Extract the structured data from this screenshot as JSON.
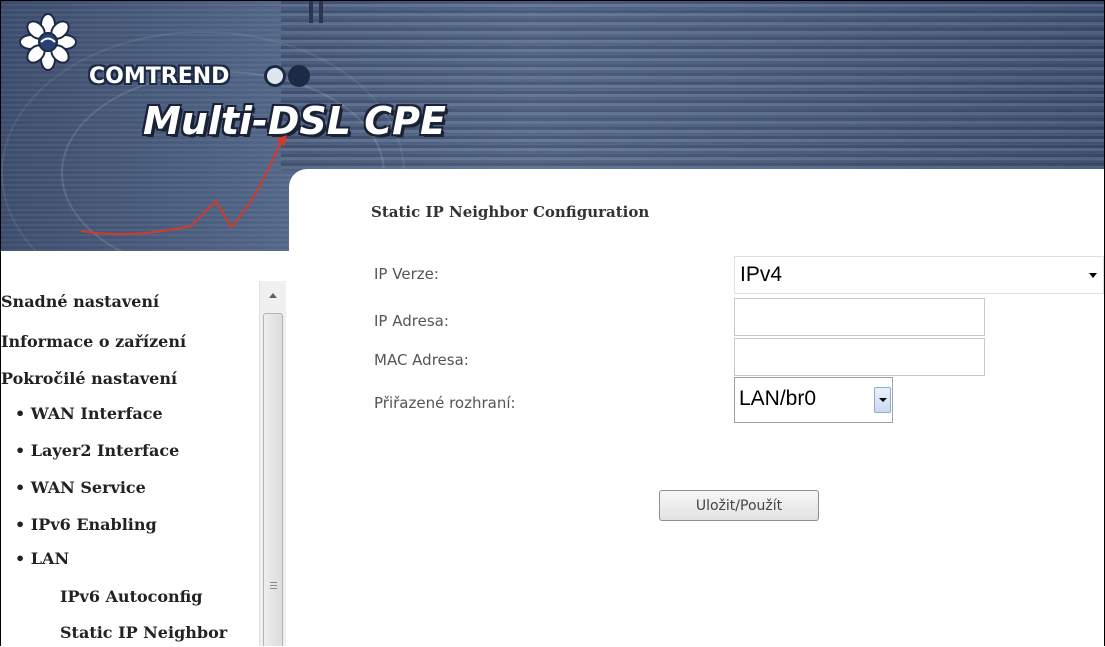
{
  "header": {
    "brand": "COMTREND",
    "product": "Multi-DSL CPE",
    "logo_icon": "flower-logo-icon"
  },
  "sidebar": {
    "items": [
      {
        "label": "Snadné nastavení"
      },
      {
        "label": "Informace o zařízení"
      },
      {
        "label": "Pokročilé nastavení"
      },
      {
        "label": "• WAN Interface"
      },
      {
        "label": "• Layer2 Interface"
      },
      {
        "label": "• WAN Service"
      },
      {
        "label": "• IPv6 Enabling"
      },
      {
        "label": "• LAN"
      },
      {
        "label": "IPv6 Autoconfig"
      },
      {
        "label": "Static IP Neighbor"
      }
    ]
  },
  "main": {
    "title": "Static IP Neighbor Configuration",
    "fields": {
      "ip_version": {
        "label": "IP Verze:",
        "value": "IPv4"
      },
      "ip_address": {
        "label": "IP Adresa:",
        "value": ""
      },
      "mac_address": {
        "label": "MAC Adresa:",
        "value": ""
      },
      "interface": {
        "label": "Přiřazené rozhraní:",
        "value": "LAN/br0"
      }
    },
    "save_label": "Uložit/Použít"
  },
  "colors": {
    "banner": "#4f6283",
    "text": "#222222",
    "label": "#555555"
  }
}
